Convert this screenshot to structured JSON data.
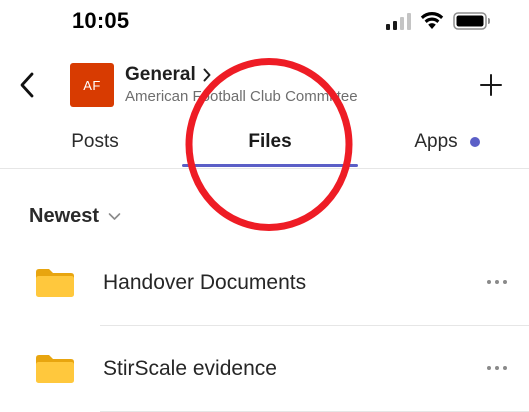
{
  "status_bar": {
    "time": "10:05",
    "signal_icon": "cellular-signal-icon",
    "wifi_icon": "wifi-icon",
    "battery_icon": "battery-icon"
  },
  "header": {
    "back_icon": "chevron-left-icon",
    "avatar_initials": "AF",
    "avatar_color": "#d83b01",
    "channel_title": "General",
    "team_name": "American Football Club Committee",
    "add_icon": "plus-icon"
  },
  "tabs": [
    {
      "label": "Posts",
      "active": false
    },
    {
      "label": "Files",
      "active": true
    },
    {
      "label": "Apps",
      "active": false,
      "has_notification_dot": true
    }
  ],
  "colors": {
    "accent": "#5b5fc7",
    "annotation": "#ee1c25",
    "folder": "#ffc83d",
    "folder_back": "#e8a50f"
  },
  "sort": {
    "label": "Newest",
    "icon": "chevron-down-icon"
  },
  "files": [
    {
      "name": "Handover Documents",
      "type_icon": "folder-icon",
      "more_icon": "more-horizontal-icon"
    },
    {
      "name": "StirScale evidence",
      "type_icon": "folder-icon",
      "more_icon": "more-horizontal-icon"
    }
  ]
}
